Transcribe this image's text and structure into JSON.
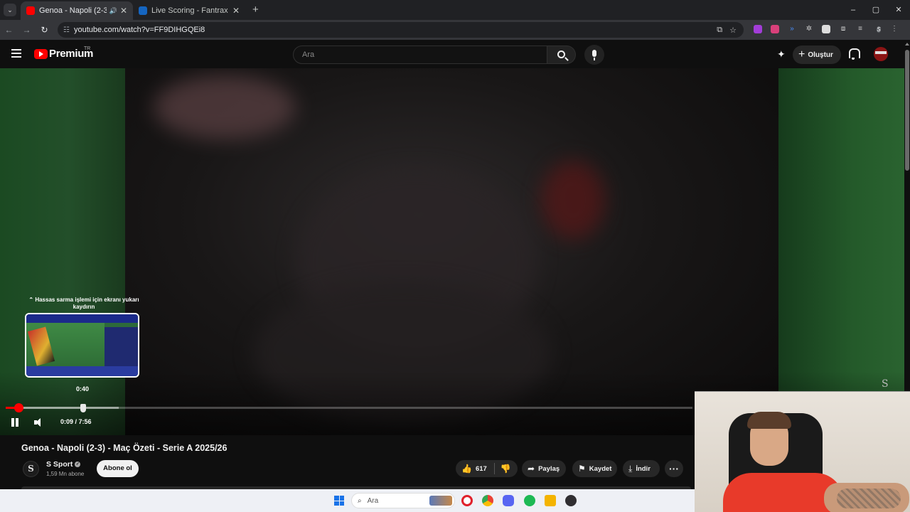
{
  "browser": {
    "tabs": [
      {
        "title": "Genoa - Napoli (2-3) - Maç",
        "active": true,
        "favicon_color": "#ff0000",
        "audio": true
      },
      {
        "title": "Live Scoring - Fantrax",
        "active": false,
        "favicon_color": "#1565c0",
        "audio": false
      }
    ],
    "url": "youtube.com/watch?v=FF9DIHGQEi8",
    "new_tab_glyph": "+",
    "window_controls": [
      "–",
      "▢",
      "✕"
    ]
  },
  "masthead": {
    "logo_text": "Premium",
    "country_code": "TR",
    "search_placeholder": "Ara",
    "create_label": "Oluştur"
  },
  "player": {
    "seek_hint": "Hassas sarma işlemi için ekranı yukarı kaydırın",
    "preview_time": "0:40",
    "current_time": "0:09",
    "duration": "7:56",
    "time_display": "0:09 / 7:56",
    "progress_fraction": 0.019,
    "buffer_fraction": 0.165,
    "state": "playing",
    "watermark": "S"
  },
  "video": {
    "title": "Genoa - Napoli (2-3) - Maç Özeti - Serie A 2025/26",
    "channel_name": "S Sport",
    "channel_initial": "S",
    "subscribers": "1,59 Mn abone",
    "subscribe_label": "Abone ol",
    "like_count": "617",
    "share_label": "Paylaş",
    "save_label": "Kaydet",
    "download_label": "İndir",
    "more_label": "···"
  },
  "taskbar": {
    "search_placeholder": "Ara",
    "pinned": [
      "opera-icon",
      "chrome-icon",
      "discord-icon",
      "spotify-icon",
      "file-explorer-icon",
      "obs-icon"
    ]
  },
  "colors": {
    "youtube_red": "#ff0000",
    "background": "#0f0f0f",
    "pill": "#272727"
  }
}
